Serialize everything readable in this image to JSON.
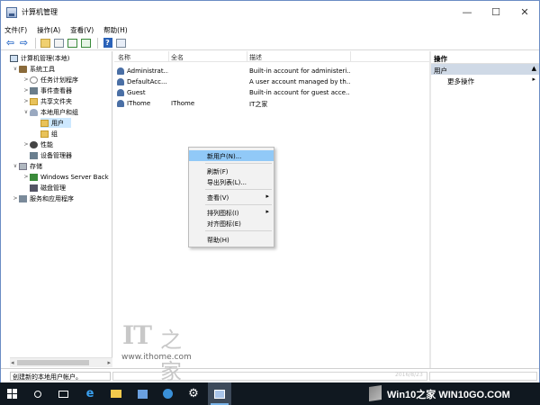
{
  "window": {
    "title": "计算机管理",
    "controls": {
      "minimize": "—",
      "maximize": "☐",
      "close": "✕"
    }
  },
  "menubar": [
    "文件(F)",
    "操作(A)",
    "查看(V)",
    "帮助(H)"
  ],
  "toolbar": [
    "back-arrow-icon",
    "forward-arrow-icon",
    "up-folder-icon",
    "show-tree-icon",
    "refresh-icon",
    "export-icon",
    "help-icon",
    "properties-icon"
  ],
  "tree": {
    "root": "计算机管理(本地)",
    "items": [
      {
        "label": "系统工具",
        "icon": "tool"
      },
      {
        "label": "任务计划程序",
        "icon": "clock"
      },
      {
        "label": "事件查看器",
        "icon": "event"
      },
      {
        "label": "共享文件夹",
        "icon": "folder"
      },
      {
        "label": "本地用户和组",
        "icon": "users"
      },
      {
        "label": "用户",
        "icon": "folder"
      },
      {
        "label": "组",
        "icon": "folder"
      },
      {
        "label": "性能",
        "icon": "perf"
      },
      {
        "label": "设备管理器",
        "icon": "dev"
      },
      {
        "label": "存储",
        "icon": "store"
      },
      {
        "label": "Windows Server Back",
        "icon": "backup"
      },
      {
        "label": "磁盘管理",
        "icon": "disk"
      },
      {
        "label": "服务和应用程序",
        "icon": "svc"
      }
    ]
  },
  "list": {
    "columns": [
      "名称",
      "全名",
      "描述"
    ],
    "rows": [
      {
        "name": "Administrat...",
        "fullname": "",
        "desc": "Built-in account for administeri..."
      },
      {
        "name": "DefaultAcc...",
        "fullname": "",
        "desc": "A user account managed by th..."
      },
      {
        "name": "Guest",
        "fullname": "",
        "desc": "Built-in account for guest acce..."
      },
      {
        "name": "IThome",
        "fullname": "IThome",
        "desc": "IT之家"
      }
    ]
  },
  "actions": {
    "header": "操作",
    "section": "用户",
    "more": "更多操作"
  },
  "context_menu": {
    "items": [
      "新用户(N)...",
      "刷新(F)",
      "导出列表(L)...",
      "查看(V)",
      "排列图标(I)",
      "对齐图标(E)",
      "帮助(H)"
    ]
  },
  "status": {
    "text": "创建新的本地用户帐户。"
  },
  "watermark": {
    "logo": "IT",
    "logo_zh": "之家",
    "url": "www.ithome.com",
    "date": "2016/8/23"
  },
  "taskbar": {
    "icons": [
      "start-icon",
      "search-icon",
      "task-view-icon",
      "edge-icon",
      "file-explorer-icon",
      "network-icon",
      "globe-icon",
      "settings-icon",
      "computer-management-icon"
    ]
  },
  "brand": {
    "text": "Win10之家 WIN10GO.COM"
  }
}
